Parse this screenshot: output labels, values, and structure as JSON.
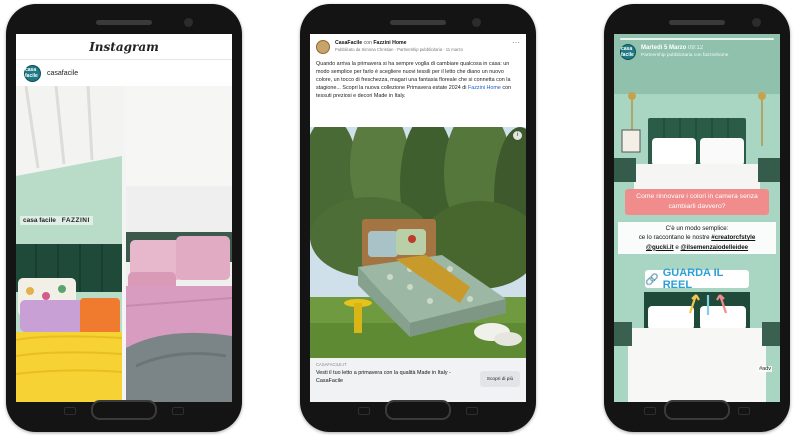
{
  "instagram": {
    "app_title": "Instagram",
    "account_handle": "casafacile",
    "avatar_text": "casa facile",
    "photo_overlay_brand": "casa facile",
    "photo_overlay_partner": "FAZZINI"
  },
  "facebook": {
    "page_name": "CasaFacile",
    "with_label": "con",
    "partner_name": "Fazzini Home",
    "byline": "Pubblicato da Simona Christian · Partnership pubblicitaria · 11 marzo",
    "post_text_before": "Quando arriva la primavera si ha sempre voglia di cambiare qualcosa in casa: un modo semplice per farlo è scegliere nuovi tessili per il letto che diano un nuovo colore, un tocco di freschezza, magari una fantasia floreale che si connetta con la stagione... Scopri la nuova collezione Primavera estate 2024 di ",
    "post_mention": "Fazzini Home",
    "post_text_after": " con tessuti preziosi e decori Made in Italy.",
    "more_icon": "···",
    "info_icon": "i",
    "cta_site": "CASAFACILE.IT",
    "cta_headline": "Vesti il tuo letto a primavera con la qualità Made in Italy - CasaFacile",
    "cta_button": "Scopri di più"
  },
  "story": {
    "avatar_text": "casa facile",
    "date": "Martedì 5 Marzo",
    "time": "09:12",
    "subtitle": "Partnership pubblicitaria con fazzinihome",
    "question": "Come rinnovare i colori in camera senza cambiarli davvero?",
    "answer_line1": "C'è un modo semplice:",
    "answer_line2_prefix": "ce lo raccontano le nostre ",
    "answer_tag1": "#creatorcfstyle",
    "answer_tag2": "@gucki.it",
    "answer_and": " e ",
    "answer_tag3": "@ilsemenzaiodelleidee",
    "reel_button": "GUARDA IL REEL",
    "adv_tag": "#adv"
  },
  "colors": {
    "story_question_bg": "#f08c8c",
    "reel_text": "#2ba0d6",
    "facebook_link": "#1a5fc8",
    "wall_mint": "#b9dcc9",
    "headboard_green": "#1f4a3a"
  }
}
